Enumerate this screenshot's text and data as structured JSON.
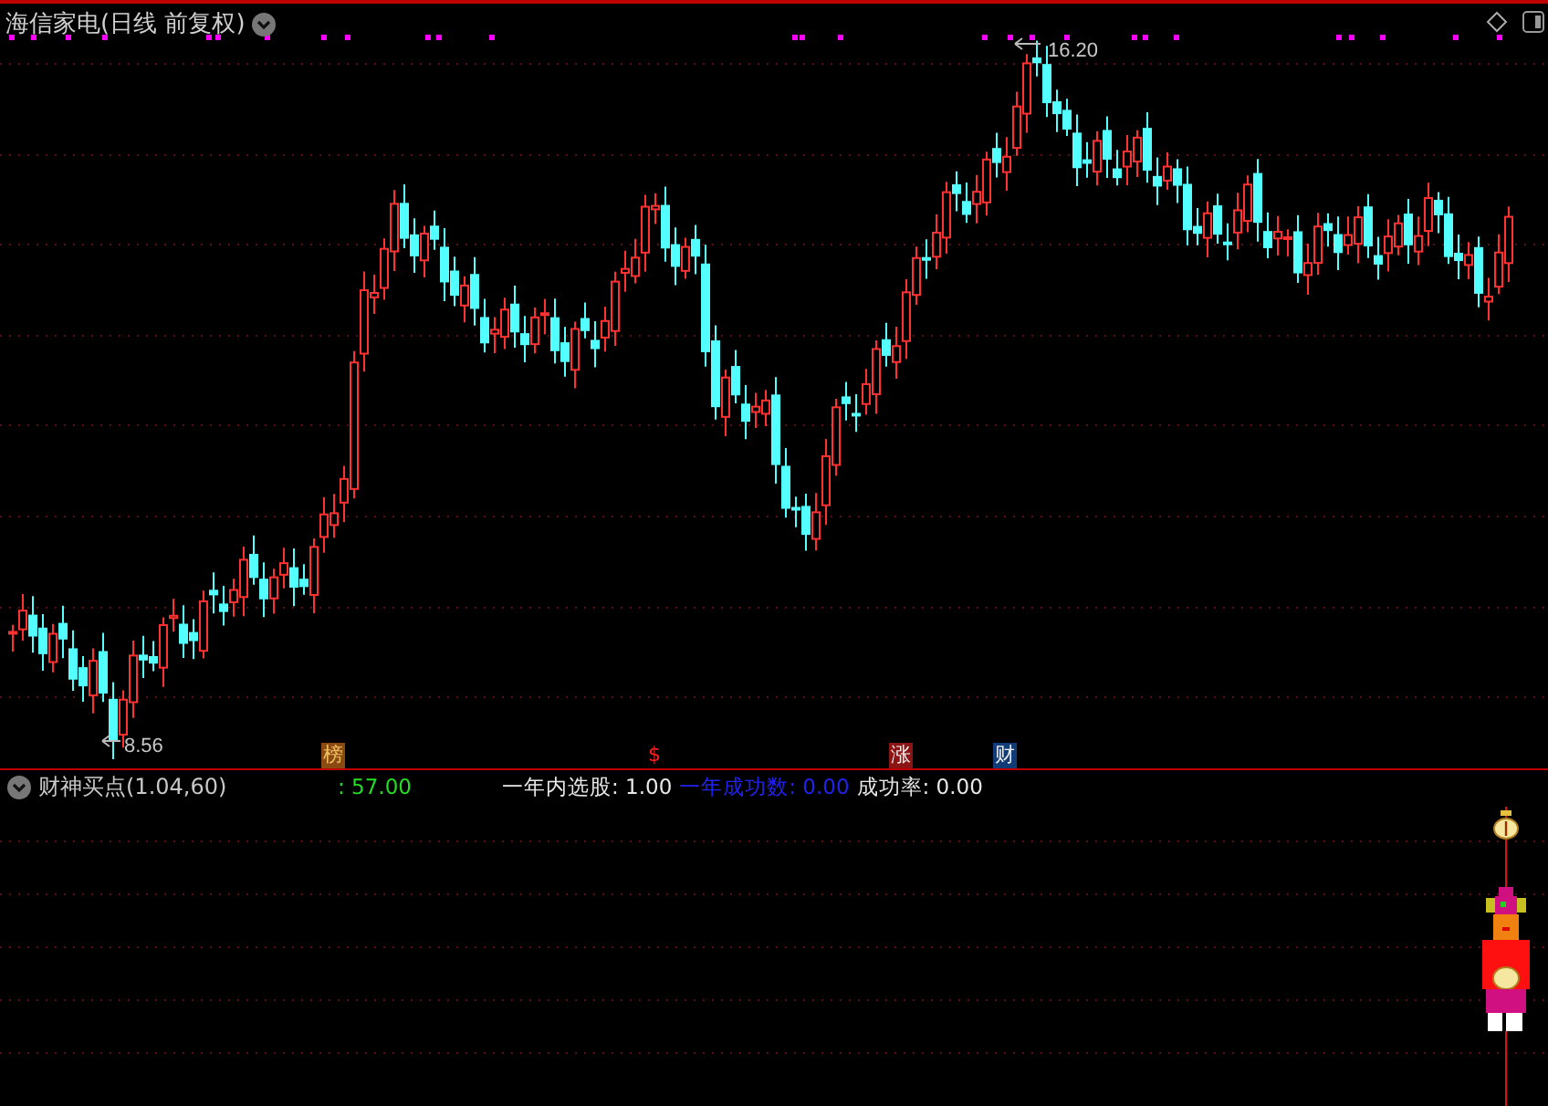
{
  "chart": {
    "title": "海信家电(日线 前复权)",
    "high_label": "16.20",
    "low_label": "8.56"
  },
  "markers": [
    {
      "text": "榜",
      "color": "#8a4a12"
    },
    {
      "text": "$",
      "color": "#000000"
    },
    {
      "text": "涨",
      "color": "#8b1414"
    },
    {
      "text": "财",
      "color": "#123c78"
    }
  ],
  "indicator": {
    "name": "财神买点(1.04,60)",
    "stats": [
      {
        "text": ": 57.00",
        "color": "#22dd22"
      },
      {
        "text": "一年内选股: 1.00",
        "color": "#e8e8e8"
      },
      {
        "text": "一年成功数: 0.00",
        "color": "#2222ee"
      },
      {
        "text": "成功率: 0.00",
        "color": "#e8e8e8"
      }
    ]
  }
}
